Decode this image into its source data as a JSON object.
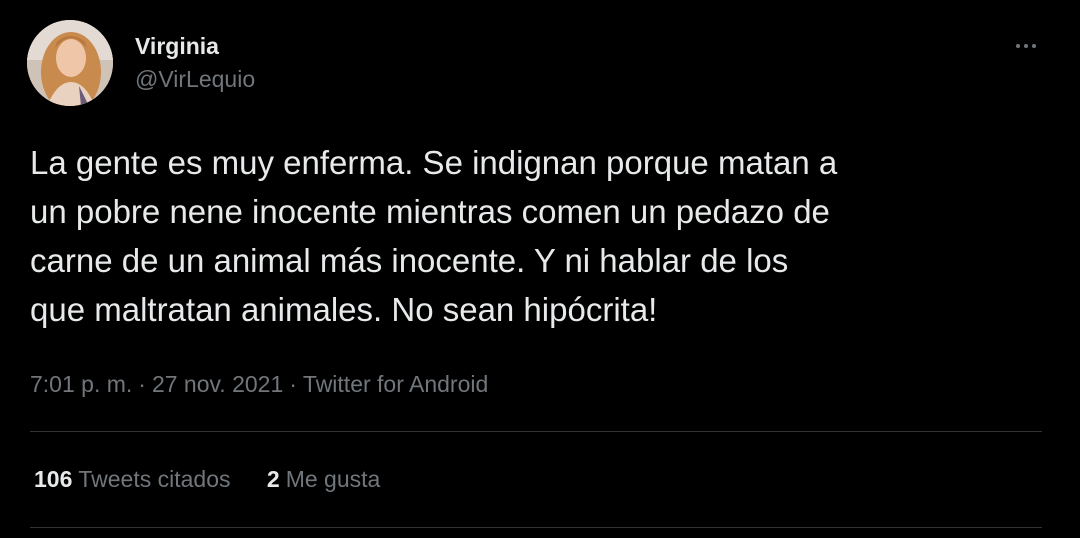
{
  "author": {
    "display_name": "Virginia",
    "handle": "@VirLequio",
    "avatar_icon": "profile-photo"
  },
  "more_icon": "more-horizontal-icon",
  "tweet": {
    "text": "La gente es muy enferma. Se indignan porque matan a\nun pobre nene inocente mientras comen un pedazo de\ncarne de un animal más inocente. Y ni hablar de los\nque maltratan animales. No sean hipócrita!"
  },
  "meta": {
    "time": "7:01 p. m.",
    "separator": "·",
    "date": "27 nov. 2021",
    "source": "Twitter for Android"
  },
  "stats": {
    "quotes_count": "106",
    "quotes_label": "Tweets citados",
    "likes_count": "2",
    "likes_label": "Me gusta"
  },
  "colors": {
    "background": "#000000",
    "text_primary": "#e7e9ea",
    "text_secondary": "#71767b",
    "divider": "#2f3336"
  }
}
